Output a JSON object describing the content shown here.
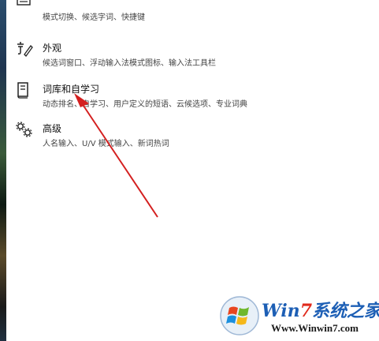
{
  "settings": {
    "items": [
      {
        "title": "",
        "desc": "模式切换、候选字词、快捷键",
        "icon": "keyboard-icon"
      },
      {
        "title": "外观",
        "desc": "候选词窗口、浮动输入法模式图标、输入法工具栏",
        "icon": "font-pen-icon"
      },
      {
        "title": "词库和自学习",
        "desc": "动态排名、自学习、用户定义的短语、云候选项、专业词典",
        "icon": "dictionary-icon"
      },
      {
        "title": "高级",
        "desc": "人名输入、U/V 模式输入、新词热词",
        "icon": "gears-icon"
      }
    ]
  },
  "annotation": {
    "color": "#d42020"
  },
  "watermark": {
    "brand_part1": "Win",
    "brand_num": "7",
    "brand_part2": "系统之家",
    "url": "Www.Winwin7.com",
    "colors": {
      "blue": "#1d5fb5",
      "red": "#e02a1c"
    }
  }
}
